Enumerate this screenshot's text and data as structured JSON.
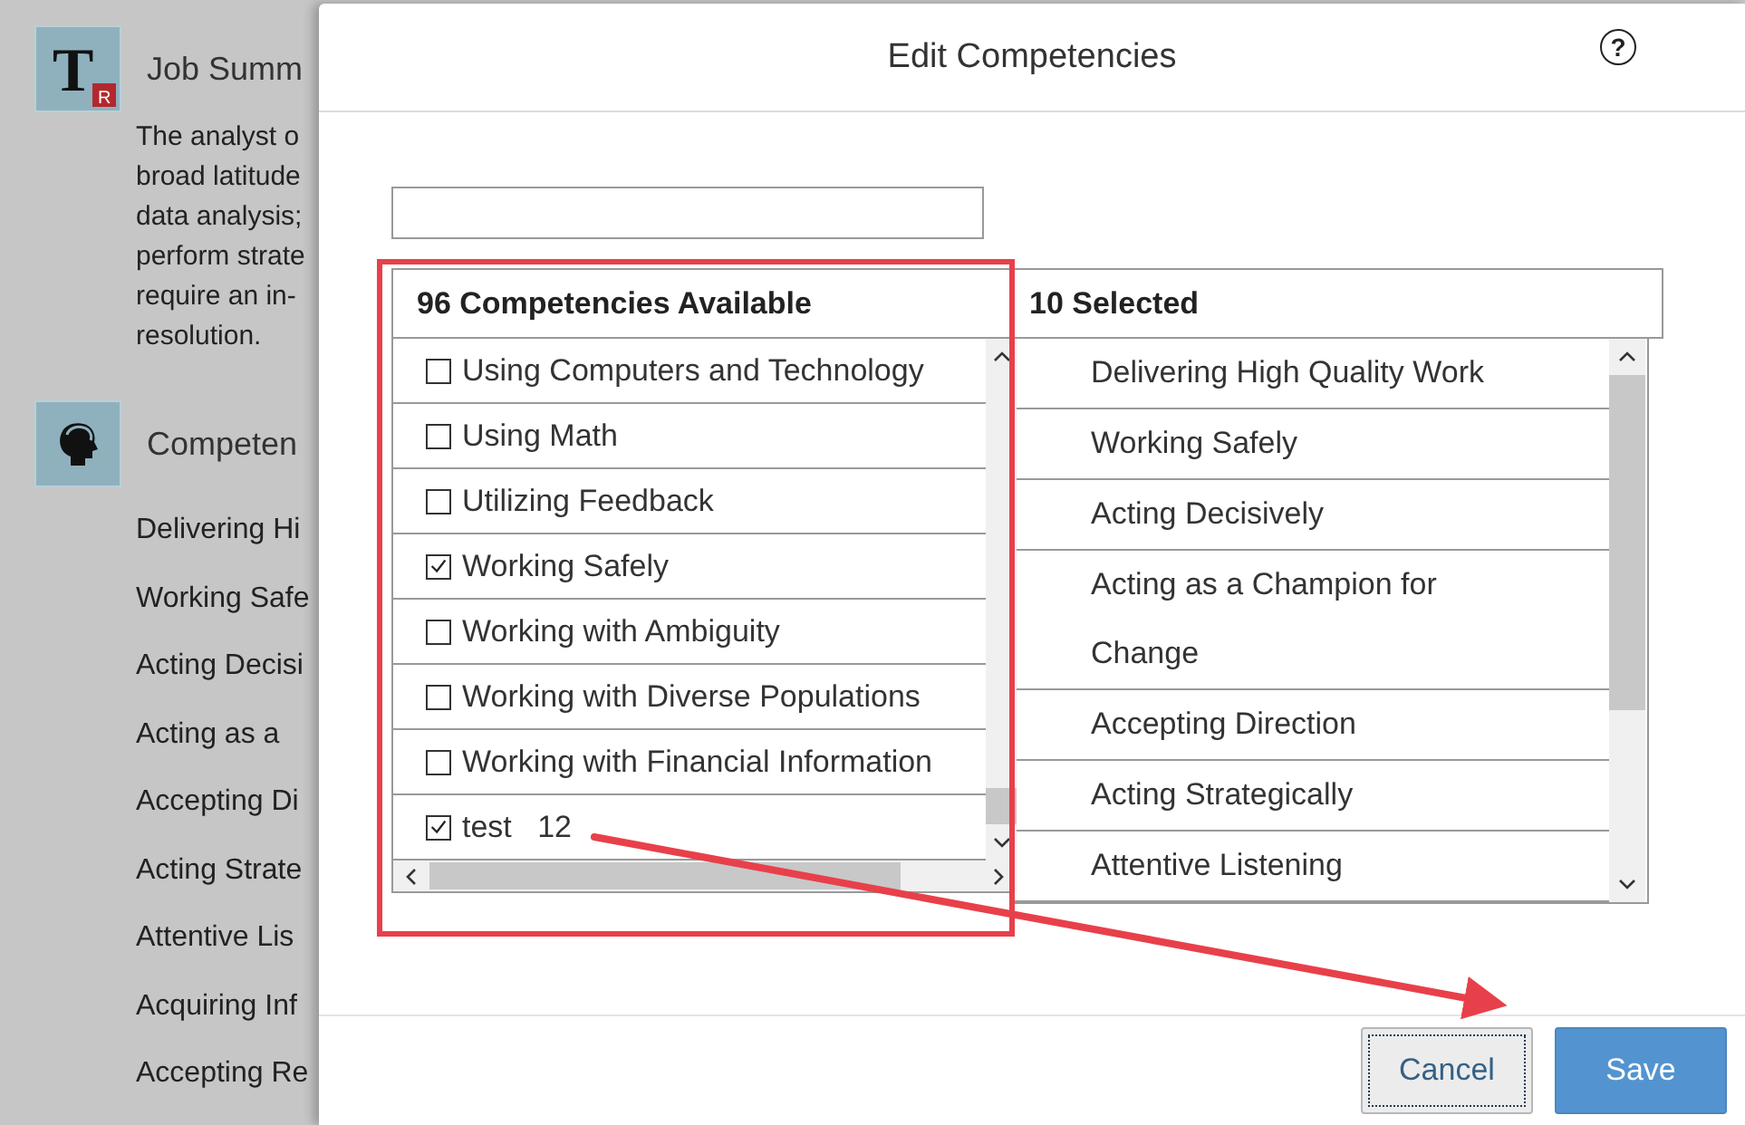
{
  "background": {
    "sections": [
      {
        "kind": "summary",
        "icon_text": "T",
        "icon_badge": "R",
        "title": "Job Summ",
        "lines": [
          "The analyst o",
          "broad latitude",
          "data analysis;",
          "perform strate",
          "require an in-",
          "resolution."
        ]
      },
      {
        "kind": "competencies",
        "title": "Competen",
        "lines": [
          "Delivering Hi",
          "Working Safe",
          "Acting Decisi",
          "Acting as a",
          "Accepting Di",
          "Acting Strate",
          "Attentive Lis",
          "Acquiring Inf",
          "Accepting Re"
        ]
      }
    ]
  },
  "dialog": {
    "title": "Edit Competencies",
    "help": "?",
    "available": {
      "header": "96 Competencies Available",
      "items": [
        {
          "label": "Using Computers and Technology",
          "checked": false
        },
        {
          "label": "Using Math",
          "checked": false
        },
        {
          "label": "Utilizing Feedback",
          "checked": false
        },
        {
          "label": "Working Safely",
          "checked": true
        },
        {
          "label": "Working with Ambiguity",
          "checked": false
        },
        {
          "label": "Working with Diverse Populations",
          "checked": false
        },
        {
          "label": "Working with Financial Information",
          "checked": false
        },
        {
          "label": "test   12",
          "checked": true
        }
      ]
    },
    "selected": {
      "header": "10 Selected",
      "items": [
        "Delivering High Quality Work",
        "Working Safely",
        "Acting Decisively",
        "Acting as a Champion for Change",
        "Accepting Direction",
        "Acting Strategically",
        "Attentive Listening"
      ]
    },
    "buttons": [
      {
        "label": "Cancel",
        "kind": "secondary",
        "focused": true
      },
      {
        "label": "Save",
        "kind": "primary",
        "focused": false
      }
    ]
  }
}
